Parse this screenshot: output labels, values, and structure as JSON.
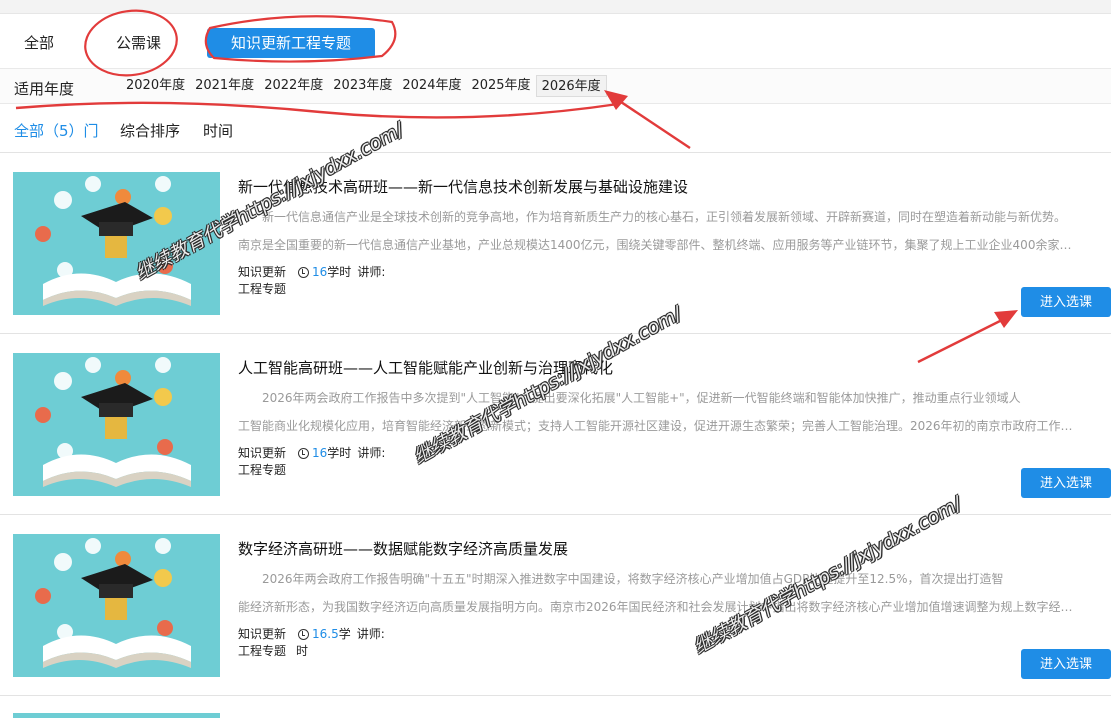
{
  "tabs": {
    "all": "全部",
    "public": "公需课",
    "special": "知识更新工程专题"
  },
  "year_filter": {
    "label": "适用年度",
    "years": [
      "2020年度",
      "2021年度",
      "2022年度",
      "2023年度",
      "2024年度",
      "2025年度",
      "2026年度"
    ],
    "selected": "2026年度"
  },
  "sort": {
    "all": "全部（5）门",
    "comprehensive": "综合排序",
    "time": "时间"
  },
  "courses": [
    {
      "title": "新一代信息技术高研班——新一代信息技术创新发展与基础设施建设",
      "desc1": "新一代信息通信产业是全球技术创新的竞争高地，作为培育新质生产力的核心基石，正引领着发展新领域、开辟新赛道，同时在塑造着新动能与新优势。",
      "desc2": "南京是全国重要的新一代信息通信产业基地，产业总规模达1400亿元，围绕关键零部件、整机终端、应用服务等产业链环节，集聚了规上工业企业400余家…",
      "category_1": "知识更新",
      "hours": "16",
      "hours_unit": "学时",
      "lecturer_label": "讲师:",
      "category_2": "工程专题",
      "hours_unit_extra": "",
      "button": "进入选课"
    },
    {
      "title": "人工智能高研班——人工智能赋能产业创新与治理现代化",
      "desc1": "2026年两会政府工作报告中多次提到\"人工智能\"，提出要深化拓展\"人工智能+\"，促进新一代智能终端和智能体加快推广，推动重点行业领域人",
      "desc2": "工智能商业化规模化应用，培育智能经济新业态新模式；支持人工智能开源社区建设，促进开源生态繁荣；完善人工智能治理。2026年初的南京市政府工作…",
      "category_1": "知识更新",
      "hours": "16",
      "hours_unit": "学时",
      "lecturer_label": "讲师:",
      "category_2": "工程专题",
      "hours_unit_extra": "",
      "button": "进入选课"
    },
    {
      "title": "数字经济高研班——数据赋能数字经济高质量发展",
      "desc1": "2026年两会政府工作报告明确\"十五五\"时期深入推进数字中国建设，将数字经济核心产业增加值占GDP比重提升至12.5%，首次提出打造智",
      "desc2": "能经济新形态，为我国数字经济迈向高质量发展指明方向。南京市2026年国民经济和社会发展计划中指出将数字经济核心产业增加值增速调整为规上数字经…",
      "category_1": "知识更新",
      "hours": "16.5",
      "hours_unit": "学",
      "lecturer_label": "讲师:",
      "category_2": "工程专题",
      "hours_unit_extra": "时",
      "button": "进入选课"
    }
  ],
  "watermark": "继续教育代学https://jxjydxx.com/",
  "colors": {
    "accent": "#1f8de6",
    "thumb_bg": "#6ecdd4",
    "annotation_red": "#e23b3b"
  }
}
